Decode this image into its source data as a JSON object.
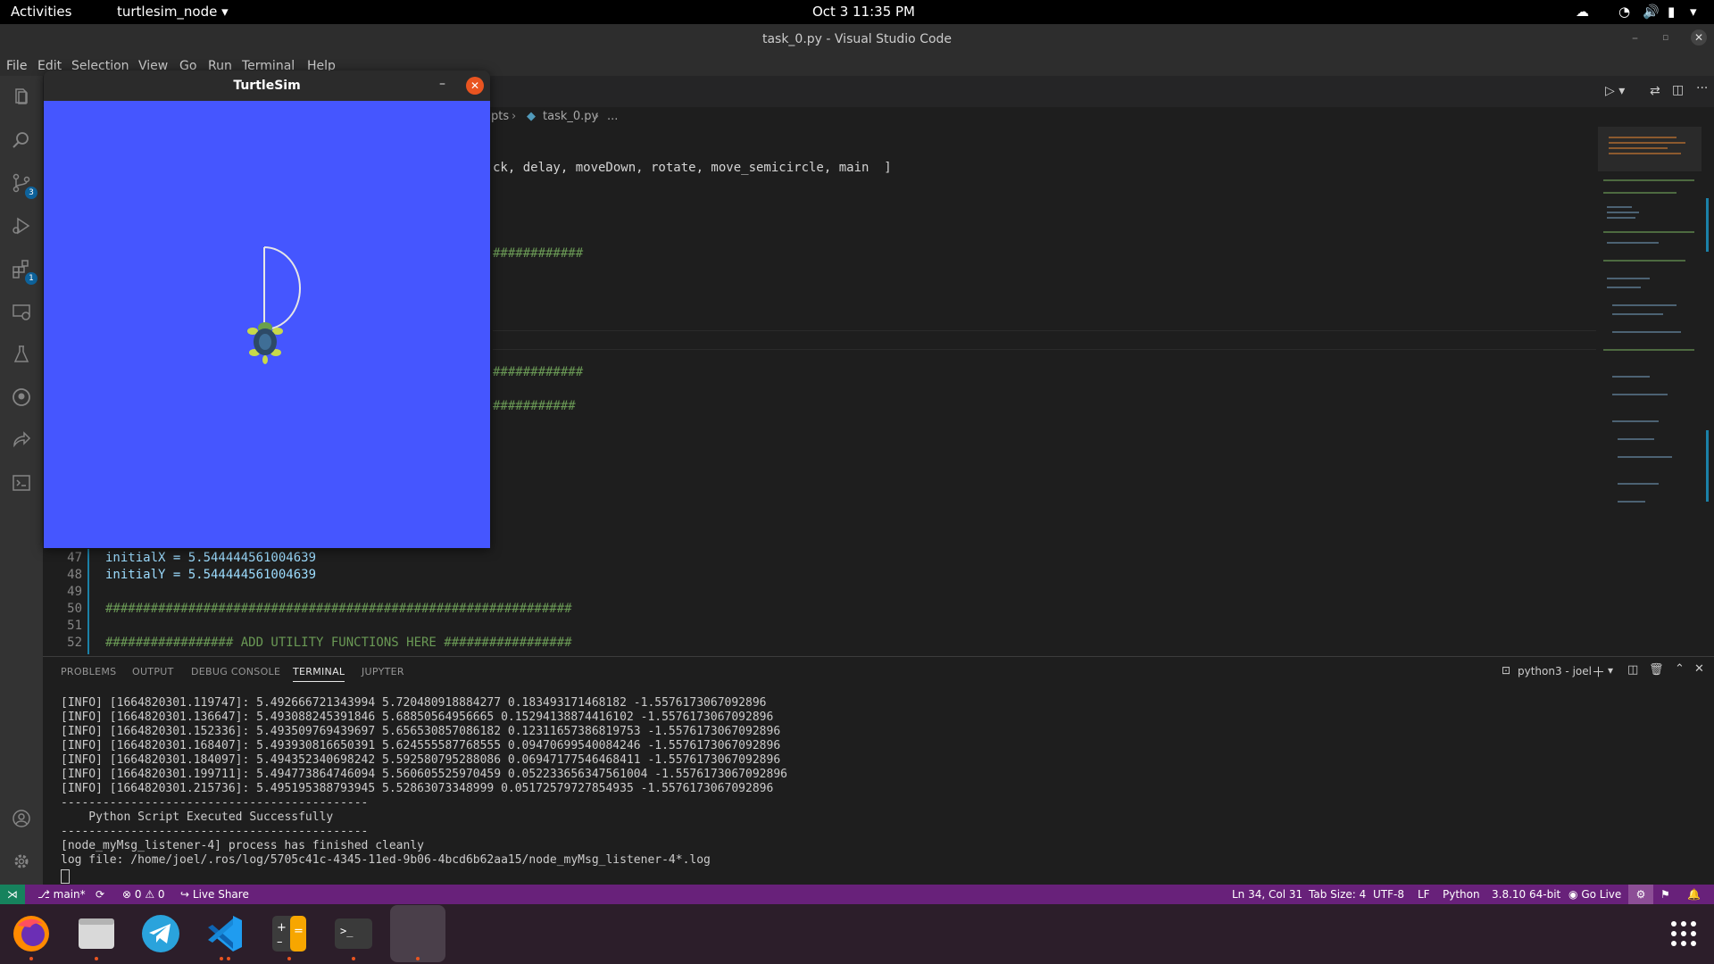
{
  "topbar": {
    "activities": "Activities",
    "app_menu": "turtlesim_node",
    "clock": "Oct 3  11:35 PM"
  },
  "vscode": {
    "window_title": "task_0.py - Visual Studio Code",
    "menu": [
      "File",
      "Edit",
      "Selection",
      "View",
      "Go",
      "Run",
      "Terminal",
      "Help"
    ],
    "breadcrumb": [
      "pts",
      "task_0.py",
      "..."
    ],
    "activity_badges": {
      "source_control": "3",
      "extensions": "1"
    },
    "code_lines": [
      {
        "text": "ck, delay, moveDown, rotate, move_semicircle, main  ]",
        "class": "plain"
      },
      {
        "text": "############",
        "class": "green"
      },
      {
        "text": "############",
        "class": "green"
      },
      {
        "text": "###########",
        "class": "green"
      }
    ],
    "numbered_lines": [
      {
        "num": "47",
        "text": "initialX = 5.544444561004639"
      },
      {
        "num": "48",
        "text": "initialY = 5.544444561004639"
      },
      {
        "num": "49",
        "text": ""
      },
      {
        "num": "50",
        "text": "##############################################################"
      },
      {
        "num": "51",
        "text": ""
      },
      {
        "num": "52",
        "text": "################# ADD UTILITY FUNCTIONS HERE #################"
      }
    ]
  },
  "panel": {
    "tabs": [
      "PROBLEMS",
      "OUTPUT",
      "DEBUG CONSOLE",
      "TERMINAL",
      "JUPYTER"
    ],
    "active_tab": "TERMINAL",
    "terminal_name": "python3 - joel",
    "terminal_lines": [
      "[INFO] [1664820301.119747]: 5.492666721343994 5.720480918884277 0.183493171468182 -1.5576173067092896",
      "[INFO] [1664820301.136647]: 5.493088245391846 5.68850564956665 0.15294138874416102 -1.5576173067092896",
      "[INFO] [1664820301.152336]: 5.493509769439697 5.656530857086182 0.12311657386819753 -1.5576173067092896",
      "[INFO] [1664820301.168407]: 5.493930816650391 5.624555587768555 0.09470699540084246 -1.5576173067092896",
      "[INFO] [1664820301.184097]: 5.494352340698242 5.592580795288086 0.06947177546468411 -1.5576173067092896",
      "[INFO] [1664820301.199711]: 5.494773864746094 5.560605525970459 0.052233656347561004 -1.5576173067092896",
      "[INFO] [1664820301.215736]: 5.495195388793945 5.52863073348999 0.05172579727854935 -1.5576173067092896",
      "--------------------------------------------",
      "    Python Script Executed Successfully",
      "--------------------------------------------",
      "[node_myMsg_listener-4] process has finished cleanly",
      "log file: /home/joel/.ros/log/5705c41c-4345-11ed-9b06-4bcd6b62aa15/node_myMsg_listener-4*.log"
    ]
  },
  "statusbar": {
    "branch": "main*",
    "problems": "⊗ 0 ⚠ 0",
    "live_share": "Live Share",
    "position": "Ln 34, Col 31",
    "tab_size": "Tab Size: 4",
    "encoding": "UTF-8",
    "eol": "LF",
    "language": "Python",
    "interpreter": "3.8.10 64-bit",
    "go_live": "Go Live"
  },
  "turtlesim": {
    "title": "TurtleSim",
    "background": "#4556ff"
  },
  "colors": {
    "statusbar": "#68217a",
    "accent": "#0e639c"
  }
}
